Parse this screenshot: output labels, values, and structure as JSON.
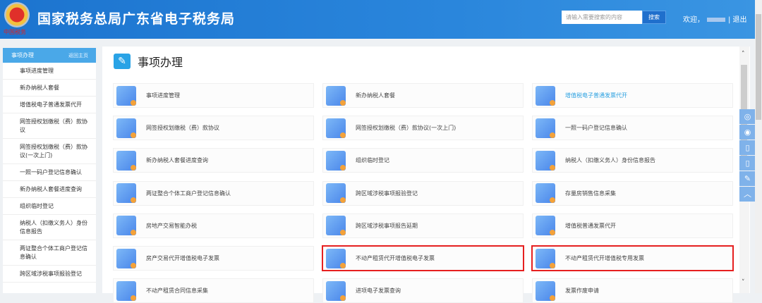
{
  "header": {
    "title": "国家税务总局广东省电子税务局",
    "emblem_text": "中国税务",
    "search_placeholder": "请输入需要搜索的内容",
    "search_button": "搜索",
    "welcome": "欢迎，",
    "logout": "| 退出"
  },
  "sidebar": {
    "title": "事项办理",
    "home_link": "返回主页",
    "items": [
      "事项进度管理",
      "新办纳税人套餐",
      "增值税电子普通发票代开",
      "网签授权划缴税（费）款协议",
      "网签授权划缴税（费）款协议(一次上门)",
      "一照一码户登记信息确认",
      "新办纳税人套餐进度查询",
      "组织临时登记",
      "纳税人（扣缴义务人）身份信息报告",
      "两证整合个体工商户登记信息确认",
      "跨区域涉税事项报验登记"
    ]
  },
  "main": {
    "title": "事项办理",
    "cards": [
      [
        "事项进度管理",
        "新办纳税人套餐",
        "增值税电子普通发票代开"
      ],
      [
        "网签授权划缴税（费）款协议",
        "网签授权划缴税（费）款协议(一次上门)",
        "一照一码户登记信息确认"
      ],
      [
        "新办纳税人套餐进度查询",
        "组织临时登记",
        "纳税人（扣缴义务人）身份信息报告"
      ],
      [
        "两证整合个体工商户登记信息确认",
        "跨区域涉税事项报验登记",
        "存量房销售信息采集"
      ],
      [
        "房地产交易智能办税",
        "跨区域涉税事项报告延期",
        "增值税普通发票代开"
      ],
      [
        "房产交易代开增值税电子发票",
        "不动产租赁代开增值税电子发票",
        "不动产租赁代开增值税专用发票"
      ],
      [
        "不动产租赁合同信息采集",
        "进项电子发票查询",
        "发票作废申请"
      ]
    ]
  },
  "float_toolbar": [
    "wechat-icon",
    "weibo-icon",
    "mobile-icon",
    "tablet-icon",
    "feedback-icon",
    "back-to-top-icon"
  ],
  "colors": {
    "header": "#1c74cf",
    "accent": "#4aa8e8",
    "highlight": "#e62020"
  }
}
